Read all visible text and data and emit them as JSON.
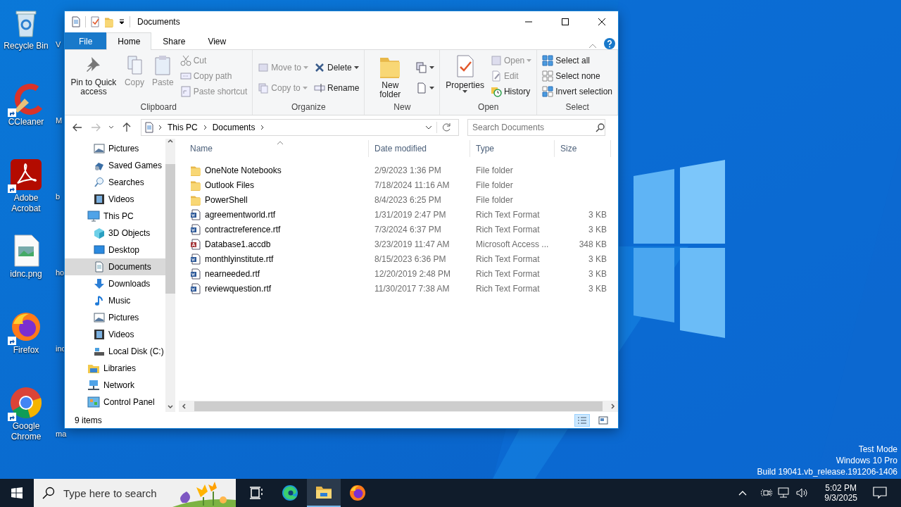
{
  "desktop_icons": [
    {
      "label": "Recycle Bin",
      "shortcut": false
    },
    {
      "label": "CCleaner",
      "shortcut": true
    },
    {
      "label": "Adobe Acrobat",
      "shortcut": true
    },
    {
      "label": "idnc.png",
      "shortcut": false
    },
    {
      "label": "Firefox",
      "shortcut": true
    },
    {
      "label": "Google Chrome",
      "shortcut": true
    }
  ],
  "covered_desktop_labels": [
    "V",
    "M",
    "b",
    "ho",
    "inc",
    "ma"
  ],
  "window": {
    "title": "Documents",
    "tabs": [
      {
        "label": "File",
        "kind": "file",
        "selected": false
      },
      {
        "label": "Home",
        "kind": "tab",
        "selected": true
      },
      {
        "label": "Share",
        "kind": "tab",
        "selected": false
      },
      {
        "label": "View",
        "kind": "tab",
        "selected": false
      }
    ],
    "ribbon_groups": [
      {
        "label": "Clipboard",
        "columns": [
          [
            {
              "label": "Pin to Quick access",
              "disabled": false,
              "dropdown": false
            }
          ],
          [
            {
              "label": "Copy",
              "disabled": true,
              "dropdown": false
            }
          ],
          [
            {
              "label": "Paste",
              "disabled": true,
              "dropdown": false
            }
          ],
          [
            {
              "label": "Cut",
              "disabled": true,
              "dropdown": false
            },
            {
              "label": "Copy path",
              "disabled": true,
              "dropdown": false
            },
            {
              "label": "Paste shortcut",
              "disabled": true,
              "dropdown": false
            }
          ]
        ]
      },
      {
        "label": "Organize",
        "columns": [
          [
            {
              "label": "Move to",
              "disabled": true,
              "dropdown": true
            },
            {
              "label": "Copy to",
              "disabled": true,
              "dropdown": true
            }
          ],
          [
            {
              "label": "Delete",
              "disabled": false,
              "dropdown": true
            },
            {
              "label": "Rename",
              "disabled": false,
              "dropdown": false
            }
          ]
        ]
      },
      {
        "label": "New",
        "columns": [
          [
            {
              "label": "New folder",
              "disabled": false,
              "dropdown": false
            }
          ],
          [
            {
              "disabled": false,
              "dropdown": true
            },
            {
              "disabled": false,
              "dropdown": true
            }
          ]
        ]
      },
      {
        "label": "Open",
        "columns": [
          [
            {
              "label": "Properties",
              "disabled": false,
              "dropdown": true
            }
          ],
          [
            {
              "label": "Open",
              "disabled": true,
              "dropdown": true
            },
            {
              "label": "Edit",
              "disabled": true,
              "dropdown": false
            },
            {
              "label": "History",
              "disabled": false,
              "dropdown": false
            }
          ]
        ]
      },
      {
        "label": "Select",
        "columns": [
          [
            {
              "label": "Select all",
              "disabled": false,
              "dropdown": false
            },
            {
              "label": "Select none",
              "disabled": false,
              "dropdown": false
            },
            {
              "label": "Invert selection",
              "disabled": false,
              "dropdown": false
            }
          ]
        ]
      }
    ],
    "breadcrumb": [
      "This PC",
      "Documents"
    ],
    "search": {
      "placeholder": "Search Documents"
    },
    "nav_tree": [
      {
        "children": [
          {
            "label": "Pictures",
            "selected": false
          },
          {
            "label": "Saved Games",
            "selected": false
          },
          {
            "label": "Searches",
            "selected": false
          },
          {
            "label": "Videos",
            "selected": false
          }
        ]
      },
      {
        "label": "This PC",
        "selected": false,
        "children": [
          {
            "label": "3D Objects",
            "selected": false
          },
          {
            "label": "Desktop",
            "selected": false
          },
          {
            "label": "Documents",
            "selected": true
          },
          {
            "label": "Downloads",
            "selected": false
          },
          {
            "label": "Music",
            "selected": false
          },
          {
            "label": "Pictures",
            "selected": false
          },
          {
            "label": "Videos",
            "selected": false
          },
          {
            "label": "Local Disk (C:)",
            "selected": false
          }
        ]
      },
      {
        "label": "Libraries",
        "selected": false
      },
      {
        "label": "Network",
        "selected": false
      },
      {
        "label": "Control Panel",
        "selected": false
      }
    ],
    "columns": [
      {
        "label": "Name",
        "sorted": true
      },
      {
        "label": "Date modified",
        "sorted": false
      },
      {
        "label": "Type",
        "sorted": false
      },
      {
        "label": "Size",
        "sorted": false
      }
    ],
    "files": [
      {
        "name": "OneNote Notebooks",
        "date": "2/9/2023 1:36 PM",
        "type": "File folder",
        "kind": "folder"
      },
      {
        "name": "Outlook Files",
        "date": "7/18/2024 11:16 AM",
        "type": "File folder",
        "kind": "folder"
      },
      {
        "name": "PowerShell",
        "date": "8/4/2023 6:25 PM",
        "type": "File folder",
        "kind": "folder"
      },
      {
        "name": "agreementworld.rtf",
        "date": "1/31/2019 2:47 PM",
        "type": "Rich Text Format",
        "size": "3 KB",
        "kind": "rtf"
      },
      {
        "name": "contractreference.rtf",
        "date": "7/3/2024 6:37 PM",
        "type": "Rich Text Format",
        "size": "3 KB",
        "kind": "rtf"
      },
      {
        "name": "Database1.accdb",
        "date": "3/23/2019 11:47 AM",
        "type": "Microsoft Access ...",
        "size": "348 KB",
        "kind": "accdb"
      },
      {
        "name": "monthlyinstitute.rtf",
        "date": "8/15/2023 6:36 PM",
        "type": "Rich Text Format",
        "size": "3 KB",
        "kind": "rtf"
      },
      {
        "name": "nearneeded.rtf",
        "date": "12/20/2019 2:48 PM",
        "type": "Rich Text Format",
        "size": "3 KB",
        "kind": "rtf"
      },
      {
        "name": "reviewquestion.rtf",
        "date": "11/30/2017 7:38 AM",
        "type": "Rich Text Format",
        "size": "3 KB",
        "kind": "rtf"
      }
    ],
    "status": "9 items",
    "views": [
      {
        "kind": "details",
        "selected": true
      },
      {
        "kind": "tiles",
        "selected": false
      }
    ]
  },
  "system_info": [
    "Test Mode",
    "Windows 10 Pro",
    "Build 19041.vb_release.191206-1406"
  ],
  "taskbar": {
    "search": {
      "placeholder": "Type here to search"
    },
    "apps": [
      {
        "kind": "taskview",
        "active": false
      },
      {
        "kind": "edge",
        "active": false
      },
      {
        "kind": "explorer",
        "active": true
      },
      {
        "kind": "firefox",
        "active": false
      }
    ],
    "time": "5:02 PM",
    "date": "9/3/2025"
  }
}
